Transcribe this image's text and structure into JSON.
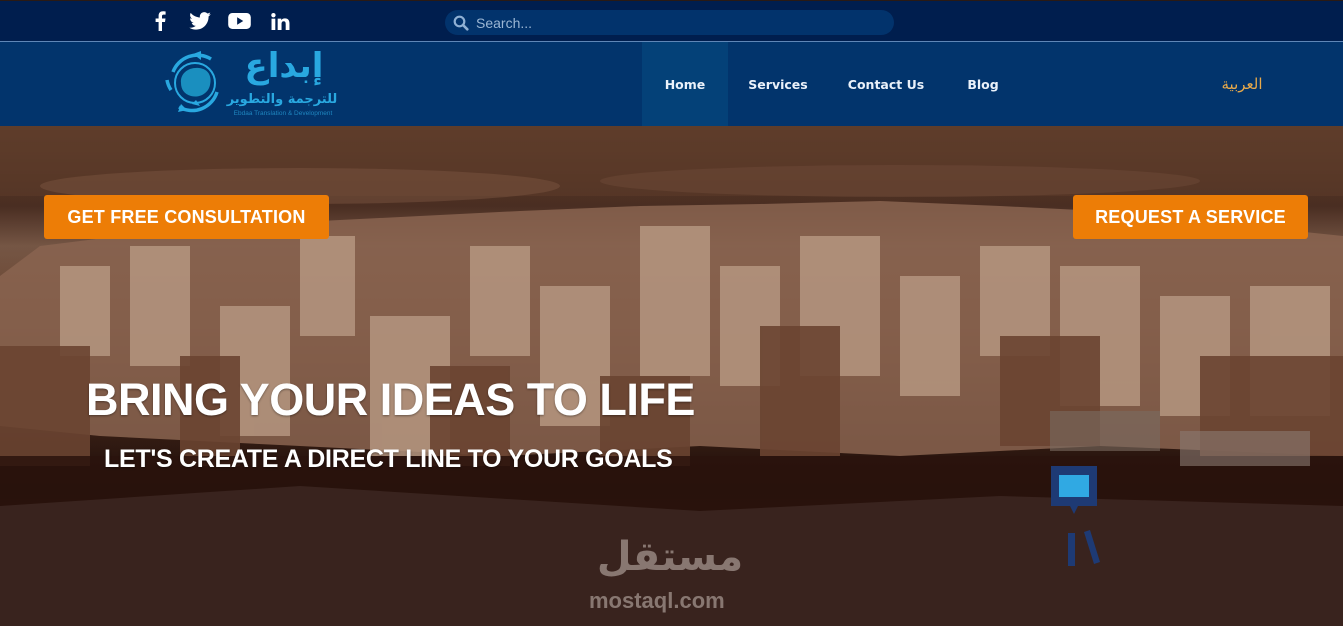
{
  "topbar": {
    "social": [
      {
        "name": "facebook",
        "icon": "facebook-icon"
      },
      {
        "name": "twitter",
        "icon": "twitter-icon"
      },
      {
        "name": "youtube",
        "icon": "youtube-icon"
      },
      {
        "name": "linkedin",
        "icon": "linkedin-icon"
      }
    ],
    "search": {
      "placeholder": "Search...",
      "value": "",
      "icon": "search-icon"
    }
  },
  "navbar": {
    "logo": {
      "arabic_title": "إبداع",
      "arabic_subtitle": "للترجمة والتطوير",
      "english_subtitle": "Ebdaa Translation & Development",
      "icon": "globe-refresh-icon"
    },
    "items": [
      {
        "label": "Home",
        "active": true
      },
      {
        "label": "Services",
        "active": false
      },
      {
        "label": "Contact Us",
        "active": false
      },
      {
        "label": "Blog",
        "active": false
      }
    ],
    "language_switch": "العربية"
  },
  "hero": {
    "cta_left": "GET FREE CONSULTATION",
    "cta_right": "REQUEST A SERVICE",
    "headline": "BRING YOUR IDEAS TO LIFE",
    "subheadline": "LET'S CREATE A DIRECT LINE TO YOUR GOALS",
    "watermark_arabic": "مستقل",
    "watermark_text": "mostaql.com"
  },
  "colors": {
    "topbar_bg": "#001e4e",
    "navbar_bg": "#02346c",
    "nav_active_bg": "#044178",
    "search_bg": "#02336c",
    "cta_orange": "#ed7d06",
    "language_gold": "#e8a94a",
    "logo_cyan": "#29a8e0"
  }
}
